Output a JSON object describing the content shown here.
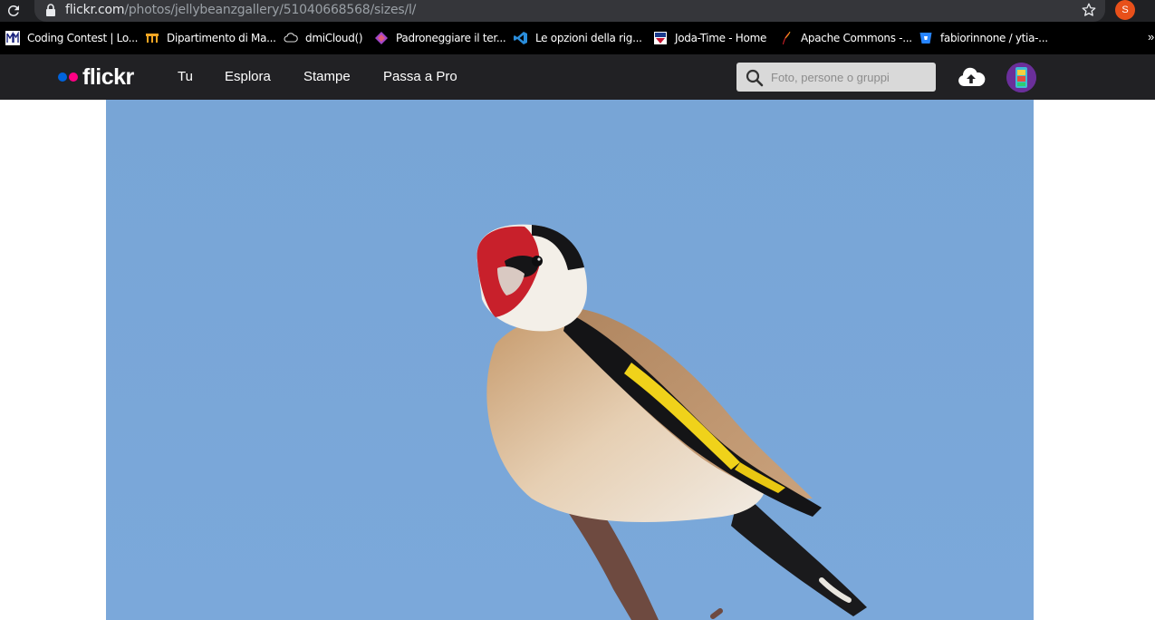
{
  "browser": {
    "url_host": "flickr.com",
    "url_path": "/photos/jellybeanzgallery/51040668568/sizes/l/",
    "profile_initial": "S",
    "bookmarks": [
      {
        "label": "Coding Contest | Lo...",
        "icon": "dm-logo-icon"
      },
      {
        "label": "Dipartimento di Ma...",
        "icon": "university-icon"
      },
      {
        "label": "dmiCloud()",
        "icon": "cloud-outline-icon"
      },
      {
        "label": "Padroneggiare il ter...",
        "icon": "gem-icon"
      },
      {
        "label": "Le opzioni della rig...",
        "icon": "vscode-icon"
      },
      {
        "label": "Joda-Time - Home",
        "icon": "joda-icon"
      },
      {
        "label": "Apache Commons -...",
        "icon": "apache-feather-icon"
      },
      {
        "label": "fabiorinnone / ytia-...",
        "icon": "bitbucket-icon"
      }
    ],
    "bookmarks_overflow": "»"
  },
  "flickr": {
    "logo": "flickr",
    "nav": [
      "Tu",
      "Esplora",
      "Stampe",
      "Passa a Pro"
    ],
    "search_placeholder": "Foto, persone o gruppi",
    "colors": {
      "blue": "#0063dc",
      "pink": "#ff0084",
      "header_bg": "#212124",
      "sky": "#7aa7d8"
    }
  },
  "photo": {
    "subject": "goldfinch-on-branch"
  }
}
